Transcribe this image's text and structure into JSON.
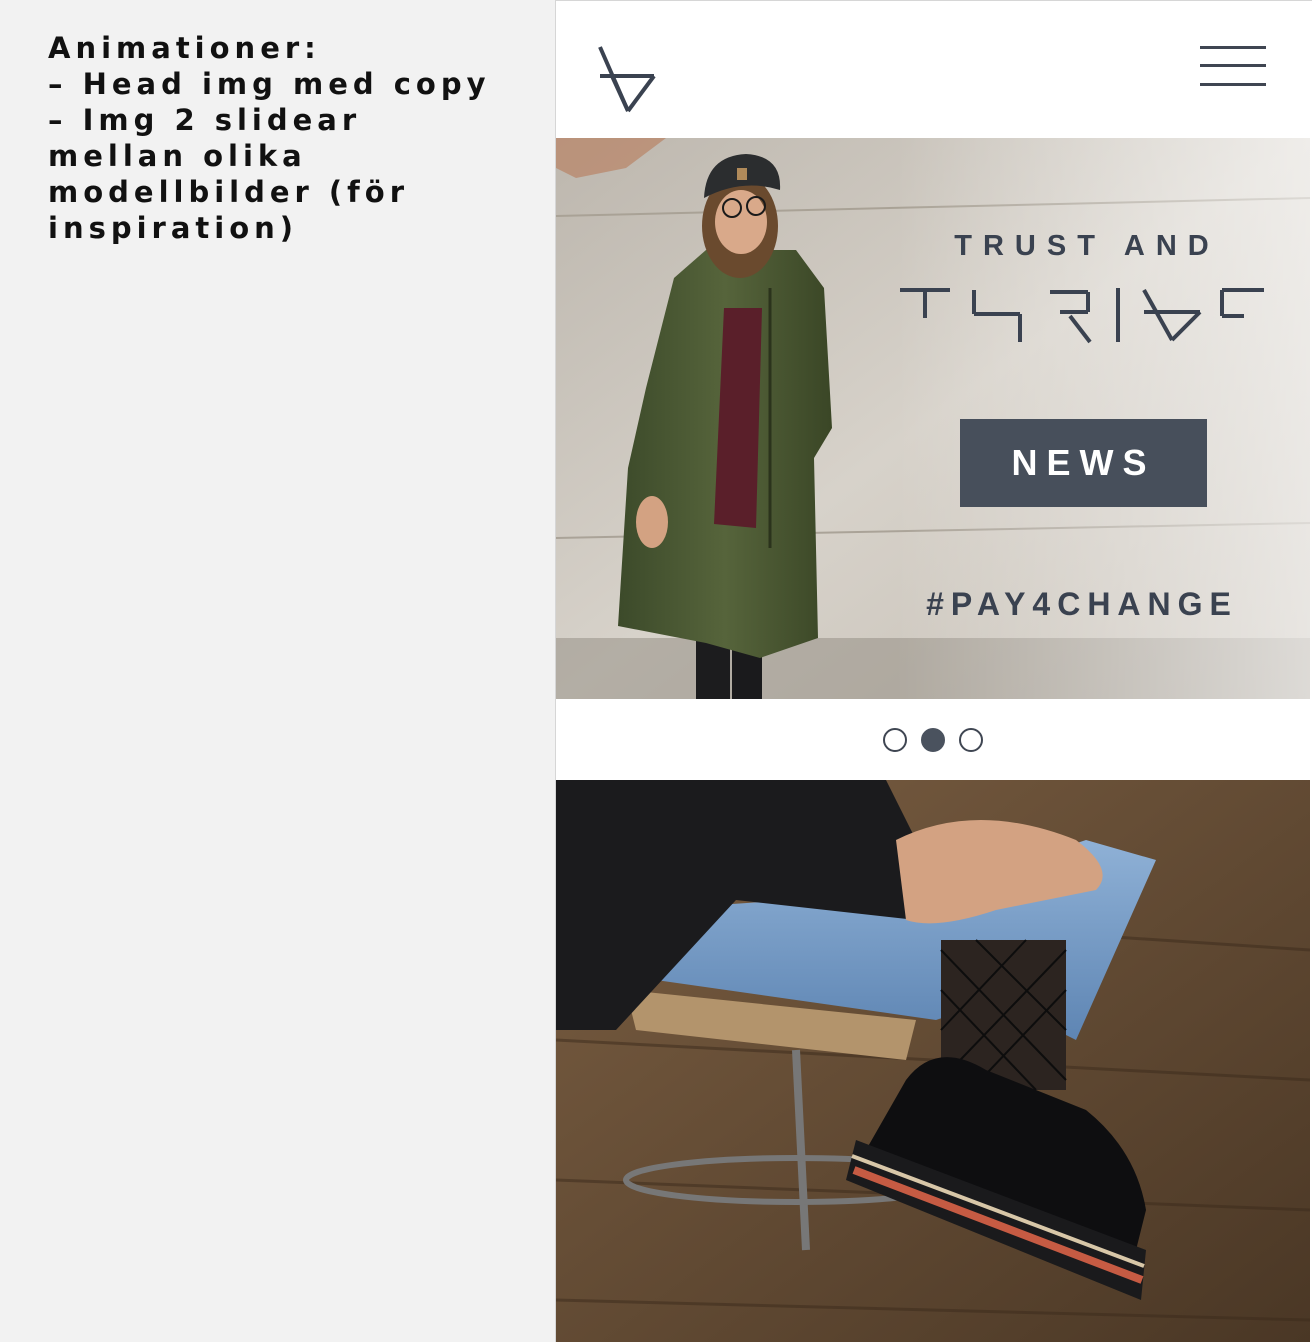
{
  "notes": {
    "lines": [
      "Animationer:",
      "– Head img med copy",
      "– Img 2 slidear",
      "mellan olika",
      "modellbilder (för",
      "inspiration)"
    ]
  },
  "header": {
    "logo_icon": "brand-triangle-logo-icon",
    "menu_icon": "hamburger-menu-icon"
  },
  "hero": {
    "tagline": "TRUST AND",
    "wordmark_icon": "thrive-wordmark",
    "button_label": "NEWS",
    "hashtag": "#PAY4CHANGE"
  },
  "carousel": {
    "slide_count": 3,
    "active_index": 1
  },
  "colors": {
    "accent": "#474f5b",
    "text_dark": "#3a4250",
    "page_bg": "#f2f2f2"
  }
}
